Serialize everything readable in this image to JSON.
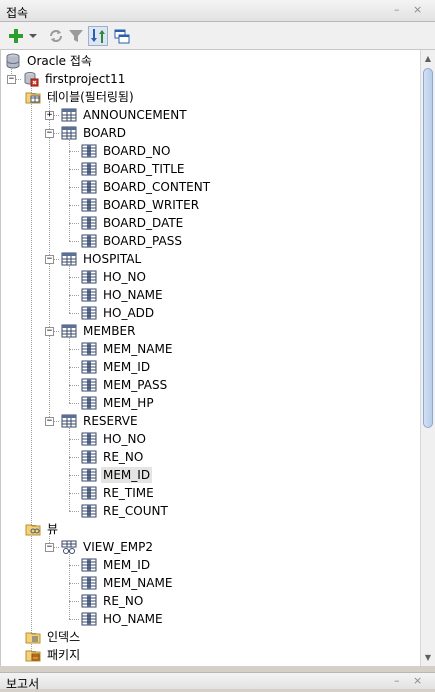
{
  "panel": {
    "title": "접속",
    "minimize": "–",
    "close": "×"
  },
  "toolbar": [
    {
      "name": "add-connection-button",
      "icon": "plus-icon",
      "pressed": false
    },
    {
      "name": "add-dropdown-button",
      "icon": "dropdown-arrow-icon",
      "pressed": false
    },
    {
      "name": "refresh-button",
      "icon": "refresh-icon",
      "pressed": false
    },
    {
      "name": "filter-button",
      "icon": "filter-icon",
      "pressed": false
    },
    {
      "name": "sort-button",
      "icon": "sort-icon",
      "pressed": true
    },
    {
      "name": "schema-browser-button",
      "icon": "schema-browser-icon",
      "pressed": false
    }
  ],
  "tree": [
    {
      "label": "Oracle 접속",
      "icon": "database-icon",
      "depth": 0,
      "expander": ""
    },
    {
      "label": "firstproject11",
      "icon": "connection-icon",
      "depth": 1,
      "expander": "−"
    },
    {
      "label": "테이블(필터링됨)",
      "icon": "folder-table-icon",
      "depth": 2,
      "expander": "−"
    },
    {
      "label": "ANNOUNCEMENT",
      "icon": "table-icon",
      "depth": 3,
      "expander": "+"
    },
    {
      "label": "BOARD",
      "icon": "table-icon",
      "depth": 3,
      "expander": "−"
    },
    {
      "label": "BOARD_NO",
      "icon": "column-icon",
      "depth": 4,
      "expander": ""
    },
    {
      "label": "BOARD_TITLE",
      "icon": "column-icon",
      "depth": 4,
      "expander": ""
    },
    {
      "label": "BOARD_CONTENT",
      "icon": "column-icon",
      "depth": 4,
      "expander": ""
    },
    {
      "label": "BOARD_WRITER",
      "icon": "column-icon",
      "depth": 4,
      "expander": ""
    },
    {
      "label": "BOARD_DATE",
      "icon": "column-icon",
      "depth": 4,
      "expander": ""
    },
    {
      "label": "BOARD_PASS",
      "icon": "column-icon",
      "depth": 4,
      "expander": ""
    },
    {
      "label": "HOSPITAL",
      "icon": "table-icon",
      "depth": 3,
      "expander": "−"
    },
    {
      "label": "HO_NO",
      "icon": "column-icon",
      "depth": 4,
      "expander": ""
    },
    {
      "label": "HO_NAME",
      "icon": "column-icon",
      "depth": 4,
      "expander": ""
    },
    {
      "label": "HO_ADD",
      "icon": "column-icon",
      "depth": 4,
      "expander": ""
    },
    {
      "label": "MEMBER",
      "icon": "table-icon",
      "depth": 3,
      "expander": "−"
    },
    {
      "label": "MEM_NAME",
      "icon": "column-icon",
      "depth": 4,
      "expander": ""
    },
    {
      "label": "MEM_ID",
      "icon": "column-icon",
      "depth": 4,
      "expander": ""
    },
    {
      "label": "MEM_PASS",
      "icon": "column-icon",
      "depth": 4,
      "expander": ""
    },
    {
      "label": "MEM_HP",
      "icon": "column-icon",
      "depth": 4,
      "expander": ""
    },
    {
      "label": "RESERVE",
      "icon": "table-icon",
      "depth": 3,
      "expander": "−"
    },
    {
      "label": "HO_NO",
      "icon": "column-icon",
      "depth": 4,
      "expander": ""
    },
    {
      "label": "RE_NO",
      "icon": "column-icon",
      "depth": 4,
      "expander": ""
    },
    {
      "label": "MEM_ID",
      "icon": "column-icon",
      "depth": 4,
      "expander": "",
      "selected": true
    },
    {
      "label": "RE_TIME",
      "icon": "column-icon",
      "depth": 4,
      "expander": ""
    },
    {
      "label": "RE_COUNT",
      "icon": "column-icon",
      "depth": 4,
      "expander": ""
    },
    {
      "label": "뷰",
      "icon": "folder-view-icon",
      "depth": 2,
      "expander": "−"
    },
    {
      "label": "VIEW_EMP2",
      "icon": "view-icon",
      "depth": 3,
      "expander": "−"
    },
    {
      "label": "MEM_ID",
      "icon": "column-icon",
      "depth": 4,
      "expander": ""
    },
    {
      "label": "MEM_NAME",
      "icon": "column-icon",
      "depth": 4,
      "expander": ""
    },
    {
      "label": "RE_NO",
      "icon": "column-icon",
      "depth": 4,
      "expander": ""
    },
    {
      "label": "HO_NAME",
      "icon": "column-icon",
      "depth": 4,
      "expander": ""
    },
    {
      "label": "인덱스",
      "icon": "folder-index-icon",
      "depth": 2,
      "expander": "+"
    },
    {
      "label": "패키지",
      "icon": "folder-package-icon",
      "depth": 2,
      "expander": "+"
    }
  ],
  "bottom_panel": {
    "title": "보고서",
    "minimize": "–",
    "close": "×"
  },
  "colors": {
    "tree_background": "#ffffff",
    "selection": "#e4e4e4",
    "scroll_thumb": "#b9cde9"
  }
}
